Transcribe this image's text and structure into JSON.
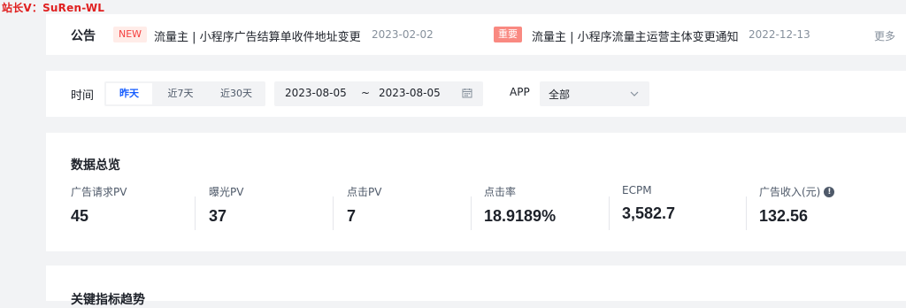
{
  "watermark": "站长V：SuRen-WL",
  "notice": {
    "title": "公告",
    "items": [
      {
        "tag": "NEW",
        "text": "流量主 | 小程序广告结算单收件地址变更",
        "date": "2023-02-02"
      },
      {
        "tag": "重要",
        "text": "流量主 | 小程序流量主运营主体变更通知",
        "date": "2022-12-13"
      }
    ],
    "more": "更多"
  },
  "filter": {
    "time_label": "时间",
    "ranges": [
      {
        "label": "昨天",
        "active": true
      },
      {
        "label": "近7天",
        "active": false
      },
      {
        "label": "近30天",
        "active": false
      }
    ],
    "start_date": "2023-08-05",
    "separator": "~",
    "end_date": "2023-08-05",
    "app_label": "APP",
    "app_value": "全部"
  },
  "overview": {
    "title": "数据总览",
    "metrics": [
      {
        "label": "广告请求PV",
        "value": "45"
      },
      {
        "label": "曝光PV",
        "value": "37"
      },
      {
        "label": "点击PV",
        "value": "7"
      },
      {
        "label": "点击率",
        "value": "18.9189%"
      },
      {
        "label": "ECPM",
        "value": "3,582.7"
      },
      {
        "label": "广告收入(元)",
        "value": "132.56"
      }
    ]
  },
  "trend": {
    "title": "关键指标趋势"
  },
  "colors": {
    "accent": "#165dff",
    "new_tag": "#f53f3f",
    "important_tag": "#f98981"
  }
}
